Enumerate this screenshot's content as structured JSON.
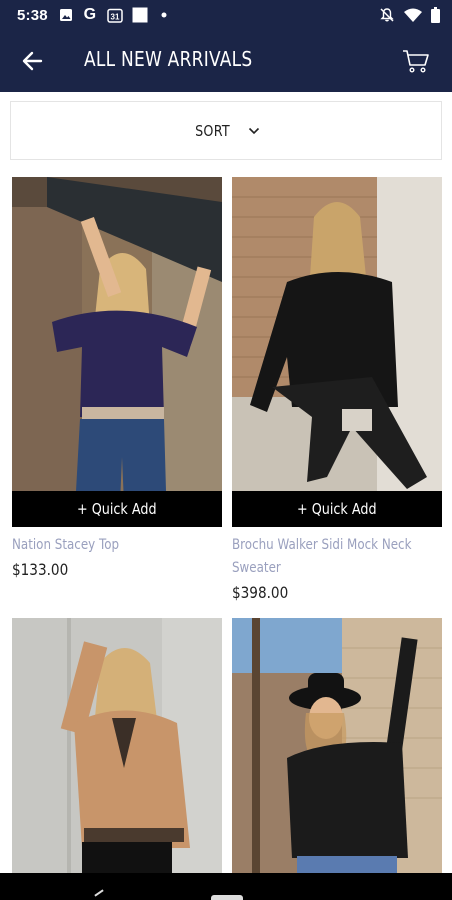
{
  "status_bar": {
    "time": "5:38",
    "icons": [
      "photo-icon",
      "google-icon",
      "calendar-31-icon",
      "square-icon",
      "dot-icon",
      "notifications-off-icon",
      "wifi-icon",
      "battery-icon"
    ],
    "calendar_day": "31"
  },
  "app_bar": {
    "title": "ALL NEW ARRIVALS",
    "back_icon": "arrow-left-icon",
    "cart_icon": "cart-icon",
    "background": "#1b2547"
  },
  "sort": {
    "label": "SORT",
    "icon": "chevron-down-icon"
  },
  "products": [
    {
      "name": "Nation Stacey Top",
      "name_line2": "",
      "price": "$133.00",
      "quick_add": "+ Quick Add"
    },
    {
      "name": "Brochu Walker Sidi Mock Neck",
      "name_line2": "Sweater",
      "price": "$398.00",
      "quick_add": "+ Quick Add"
    },
    {
      "name": "",
      "name_line2": "",
      "price": "",
      "quick_add": ""
    },
    {
      "name": "",
      "name_line2": "",
      "price": "",
      "quick_add": ""
    }
  ],
  "colors": {
    "accent": "#1b2547",
    "product_name": "#9aa0be",
    "quick_add_bg": "#000000"
  }
}
